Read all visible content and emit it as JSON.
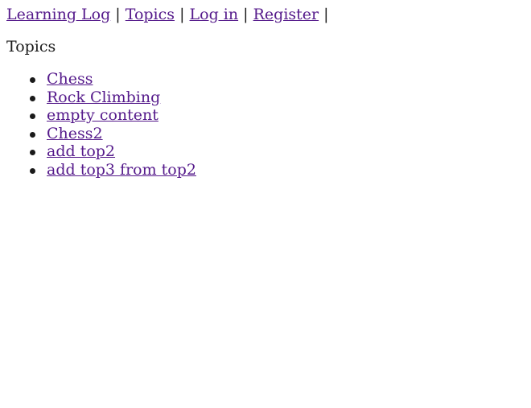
{
  "nav": {
    "home_label": "Learning Log",
    "topics_label": "Topics",
    "login_label": "Log in",
    "register_label": "Register",
    "separator": "|"
  },
  "page": {
    "title": "Topics"
  },
  "topics": [
    {
      "label": "Chess"
    },
    {
      "label": "Rock Climbing"
    },
    {
      "label": "empty content"
    },
    {
      "label": "Chess2"
    },
    {
      "label": "add top2"
    },
    {
      "label": "add top3 from top2"
    }
  ],
  "colors": {
    "link_visited": "#551a8b",
    "text": "#1a1a1a",
    "background": "#ffffff"
  }
}
